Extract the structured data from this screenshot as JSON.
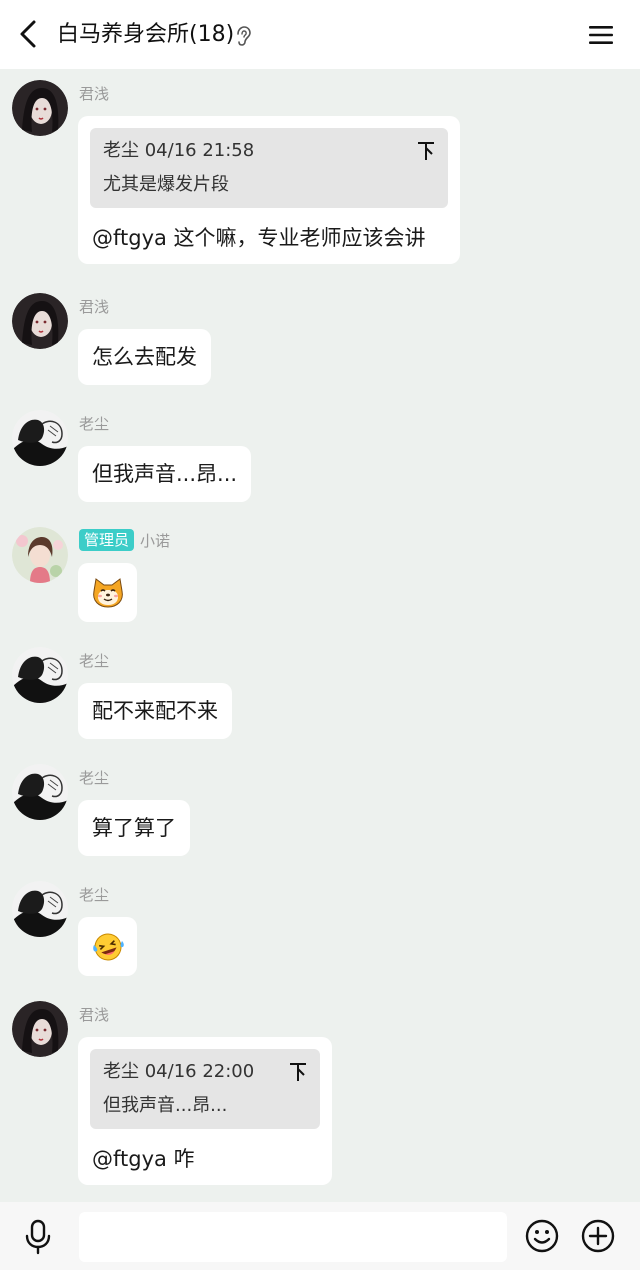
{
  "header": {
    "title": "白马养身会所(18)",
    "back_icon": "chevron-left-icon",
    "ear_icon": "ear-icon",
    "menu_icon": "hamburger-menu-icon"
  },
  "messages": [
    {
      "sender": "君浅",
      "avatar": "avatar-junqian",
      "quote": {
        "author_time": "老尘 04/16 21:58",
        "text": "尤其是爆发片段"
      },
      "text": "@ftgya 这个嘛，专业老师应该会讲"
    },
    {
      "sender": "君浅",
      "avatar": "avatar-junqian",
      "text": "怎么去配发"
    },
    {
      "sender": "老尘",
      "avatar": "avatar-laochen",
      "text": "但我声音...昂..."
    },
    {
      "sender": "小诺",
      "role": "管理员",
      "avatar": "avatar-xiaonuo",
      "emoji": "shiba-dog-emoji"
    },
    {
      "sender": "老尘",
      "avatar": "avatar-laochen",
      "text": "配不来配不来"
    },
    {
      "sender": "老尘",
      "avatar": "avatar-laochen",
      "text": "算了算了"
    },
    {
      "sender": "老尘",
      "avatar": "avatar-laochen",
      "emoji": "laughing-tears-emoji"
    },
    {
      "sender": "君浅",
      "avatar": "avatar-junqian",
      "quote": {
        "author_time": "老尘 04/16 22:00",
        "text": "但我声音...昂..."
      },
      "text": "@ftgya 咋"
    }
  ],
  "input": {
    "value": "",
    "placeholder": "",
    "mic_icon": "microphone-icon",
    "emoji_icon": "smiley-icon",
    "plus_icon": "plus-circle-icon"
  },
  "colors": {
    "background": "#edf1ee",
    "bubble": "#ffffff",
    "quote": "#e5e5e5",
    "admin_badge": "#3ccdc8",
    "sender_text": "#9a9a9a"
  }
}
